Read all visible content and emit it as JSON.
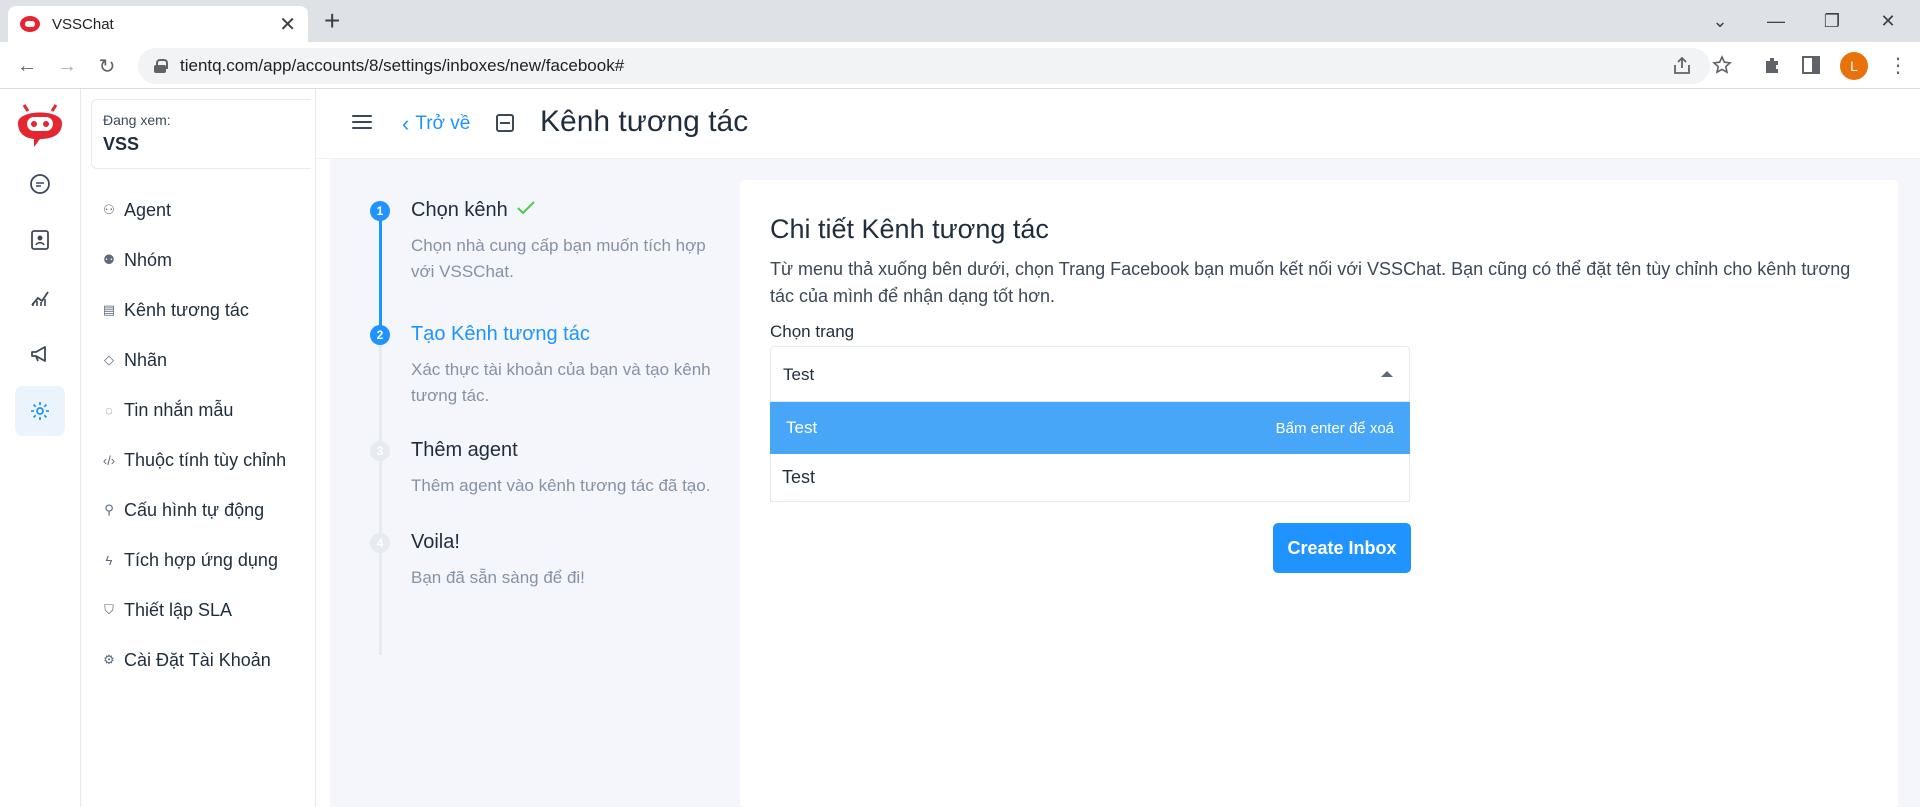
{
  "browser": {
    "tab_title": "VSSChat",
    "tab_close": "✕",
    "new_tab": "+",
    "url": "tientq.com/app/accounts/8/settings/inboxes/new/facebook#",
    "profile_initial": "L",
    "window_controls": {
      "dropdown": "⌄",
      "minimize": "—",
      "restore": "❐",
      "close": "✕"
    },
    "nav": {
      "back": "←",
      "forward": "→",
      "reload": "↻"
    }
  },
  "colors": {
    "accent": "#1f93ff",
    "brand_red": "#e3262f",
    "highlight": "#48a6f8"
  },
  "account": {
    "label": "Đang xem:",
    "name": "VSS"
  },
  "sidebar": {
    "items": [
      {
        "label": "Agent",
        "icon": "people-icon"
      },
      {
        "label": "Nhóm",
        "icon": "team-icon"
      },
      {
        "label": "Kênh tương tác",
        "icon": "inbox-icon"
      },
      {
        "label": "Nhãn",
        "icon": "tag-icon"
      },
      {
        "label": "Tin nhắn mẫu",
        "icon": "chat-icon"
      },
      {
        "label": "Thuộc tính tùy chỉnh",
        "icon": "code-icon"
      },
      {
        "label": "Cấu hình tự động",
        "icon": "automation-icon"
      },
      {
        "label": "Tích hợp ứng dụng",
        "icon": "flash-icon"
      },
      {
        "label": "Thiết lập SLA",
        "icon": "shield-icon"
      },
      {
        "label": "Cài Đặt Tài Khoản",
        "icon": "gear-icon"
      }
    ]
  },
  "header": {
    "back_label": "Trở về",
    "title": "Kênh tương tác"
  },
  "steps": [
    {
      "number": "1",
      "title": "Chọn kênh",
      "description": "Chọn nhà cung cấp bạn muốn tích hợp với VSSChat.",
      "state": "done"
    },
    {
      "number": "2",
      "title": "Tạo Kênh tương tác",
      "description": "Xác thực tài khoản của bạn và tạo kênh tương tác.",
      "state": "active"
    },
    {
      "number": "3",
      "title": "Thêm agent",
      "description": "Thêm agent vào kênh tương tác đã tạo.",
      "state": "pending"
    },
    {
      "number": "4",
      "title": "Voila!",
      "description": "Bạn đã sẵn sàng để đi!",
      "state": "pending"
    }
  ],
  "form": {
    "heading": "Chi tiết Kênh tương tác",
    "description": "Từ menu thả xuống bên dưới, chọn Trang Facebook bạn muốn kết nối với VSSChat. Bạn cũng có thể đặt tên tùy chỉnh cho kênh tương tác của mình để nhận dạng tốt hơn.",
    "page_label": "Chọn trang",
    "select_value": "Test",
    "options": [
      {
        "label": "Test",
        "hint": "Bấm enter để xoá",
        "selected": true
      },
      {
        "label": "Test",
        "hint": "",
        "selected": false
      }
    ],
    "submit_label": "Create Inbox"
  }
}
